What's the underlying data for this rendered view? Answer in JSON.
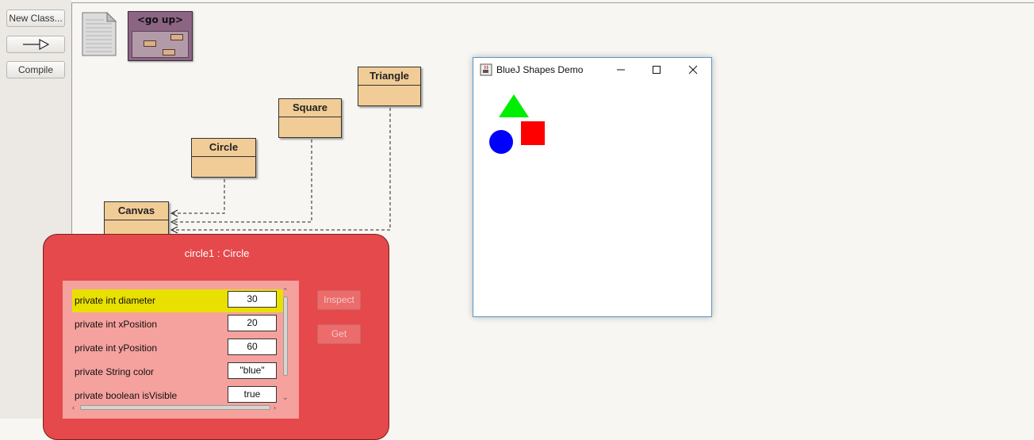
{
  "toolbar": {
    "new_class_label": "New Class...",
    "arrow_icon": "uses-arrow-icon",
    "compile_label": "Compile"
  },
  "diagram": {
    "readme_icon": "readme-document-icon",
    "go_up_label": "<go up>",
    "classes": {
      "triangle": "Triangle",
      "square": "Square",
      "circle": "Circle",
      "canvas": "Canvas"
    }
  },
  "shapes_window": {
    "title": "BlueJ Shapes Demo",
    "app_icon": "java-cup-icon",
    "controls": [
      "minimize-icon",
      "maximize-icon",
      "close-icon"
    ],
    "shapes": [
      {
        "kind": "triangle",
        "color": "#00ee00"
      },
      {
        "kind": "square",
        "color": "#ff0000"
      },
      {
        "kind": "circle",
        "color": "#0000ff"
      }
    ]
  },
  "inspector": {
    "title": "circle1 : Circle",
    "fields": [
      {
        "label": "private int diameter",
        "value": "30",
        "selected": true
      },
      {
        "label": "private int xPosition",
        "value": "20",
        "selected": false
      },
      {
        "label": "private int yPosition",
        "value": "60",
        "selected": false
      },
      {
        "label": "private String color",
        "value": "\"blue\"",
        "selected": false
      },
      {
        "label": "private boolean isVisible",
        "value": "true",
        "selected": false
      }
    ],
    "inspect_label": "Inspect",
    "get_label": "Get",
    "colors": {
      "background": "#e5494b",
      "fields_bg": "#f5a19d",
      "selection": "#e8e000"
    }
  }
}
